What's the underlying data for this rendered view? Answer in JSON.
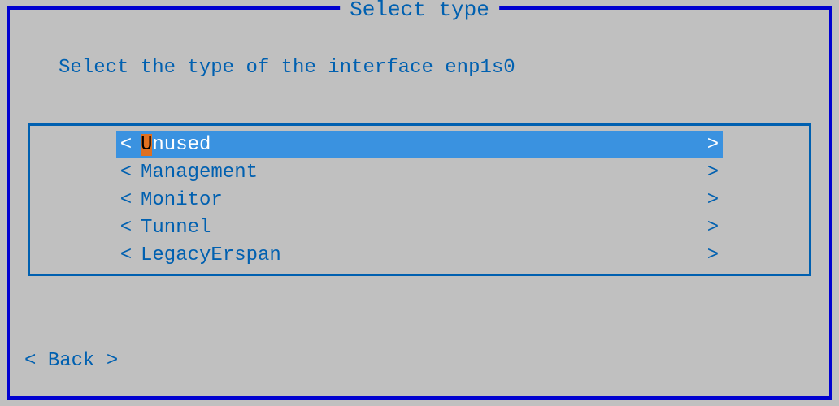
{
  "dialog": {
    "title": "Select type",
    "prompt": "Select the type of the interface enp1s0"
  },
  "menu": {
    "items": [
      {
        "label": "Unused",
        "hotkey_index": 0,
        "selected": true
      },
      {
        "label": "Management",
        "hotkey_index": null,
        "selected": false
      },
      {
        "label": "Monitor",
        "hotkey_index": null,
        "selected": false
      },
      {
        "label": "Tunnel",
        "hotkey_index": null,
        "selected": false
      },
      {
        "label": "LegacyErspan",
        "hotkey_index": null,
        "selected": false
      }
    ]
  },
  "buttons": {
    "back": "Back"
  },
  "glyphs": {
    "left_bracket": "<",
    "right_bracket": ">"
  }
}
